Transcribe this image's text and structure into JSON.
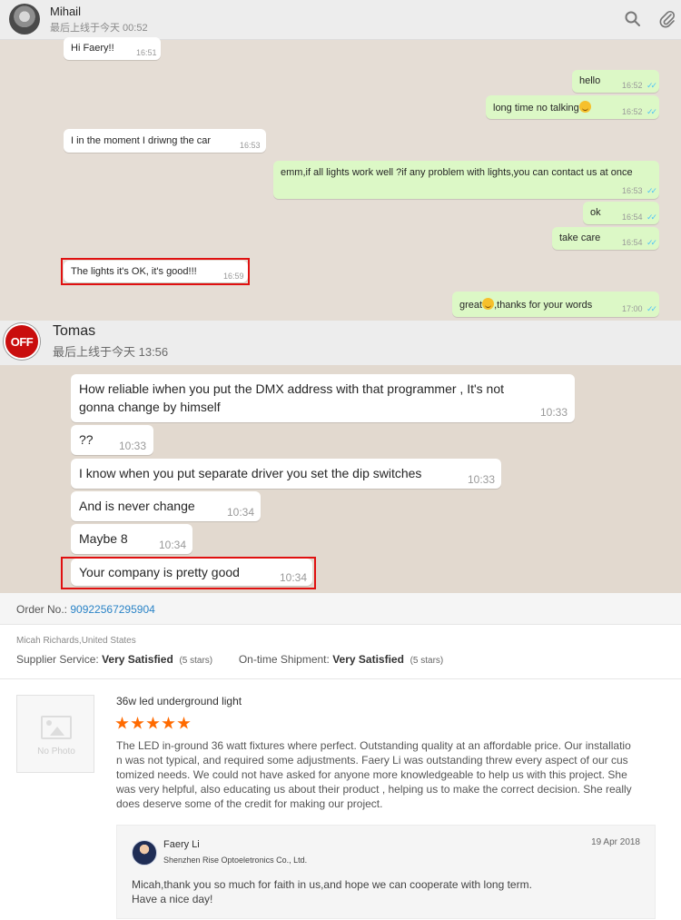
{
  "chat1": {
    "contact_name": "Mihail",
    "status": "最后上线于今天 00:52",
    "messages": [
      {
        "text": "Hi Faery!!",
        "time": "16:51"
      },
      {
        "text": "hello",
        "time": "16:52"
      },
      {
        "text": "long time no talking",
        "time": "16:52"
      },
      {
        "text": "I in the moment I driwng the car",
        "time": "16:53"
      },
      {
        "text": "emm,if all lights work well ?if any problem with lights,you can contact us at once",
        "time": "16:53"
      },
      {
        "text": "ok",
        "time": "16:54"
      },
      {
        "text": "take care",
        "time": "16:54"
      },
      {
        "text": "The lights it's OK, it's good!!!",
        "time": "16:59"
      },
      {
        "text_a": "great",
        "text_b": ",thanks for your words",
        "time": "17:00"
      }
    ]
  },
  "chat2": {
    "contact_name": "Tomas",
    "avatar_text": "OFF",
    "status": "最后上线于今天 13:56",
    "messages": [
      {
        "line1": "How reliable iwhen you put the DMX address with that programmer , It's not",
        "line2": "gonna change by himself",
        "time": "10:33"
      },
      {
        "text": "??",
        "time": "10:33"
      },
      {
        "text": "I know when you put separate driver you set the dip switches",
        "time": "10:33"
      },
      {
        "text": "And is never change",
        "time": "10:34"
      },
      {
        "text": "Maybe 8",
        "time": "10:34"
      },
      {
        "text": "Your company is pretty good",
        "time": "10:34"
      }
    ]
  },
  "review": {
    "order_label": "Order No.:",
    "order_number": "90922567295904",
    "buyer": "Micah Richards,United States",
    "supplier_label": "Supplier Service:",
    "supplier_value": "Very Satisfied",
    "supplier_stars": "(5 stars)",
    "shipment_label": "On-time Shipment:",
    "shipment_value": "Very Satisfied",
    "shipment_stars": "(5 stars)",
    "no_photo": "No Photo",
    "product_title": "36w led underground light",
    "rating": 5,
    "lines": [
      "The LED in-ground 36 watt fixtures where perfect. Outstanding quality at an affordable price. Our installatio",
      "n was not typical, and  required some adjustments. Faery Li was outstanding threw every aspect of our cus",
      "tomized needs. We could not have asked for anyone more knowledgeable to help us with this project. She",
      "was very helpful, also educating us about their product , helping us to make the correct decision. She really",
      "does deserve some of the credit for making our project."
    ],
    "reply": {
      "name": "Faery Li",
      "company": "Shenzhen Rise Optoeletronics Co., Ltd.",
      "date": "19 Apr 2018",
      "line1": "Micah,thank you so much for faith in us,and hope we can cooperate with long term.",
      "line2": "Have a nice day!"
    }
  },
  "colors": {
    "chat_bg": "#e5ddd5",
    "outgoing_bubble": "#dcf8c6",
    "highlight": "#e01010",
    "star": "#ff6a00",
    "link": "#2b84c7"
  }
}
